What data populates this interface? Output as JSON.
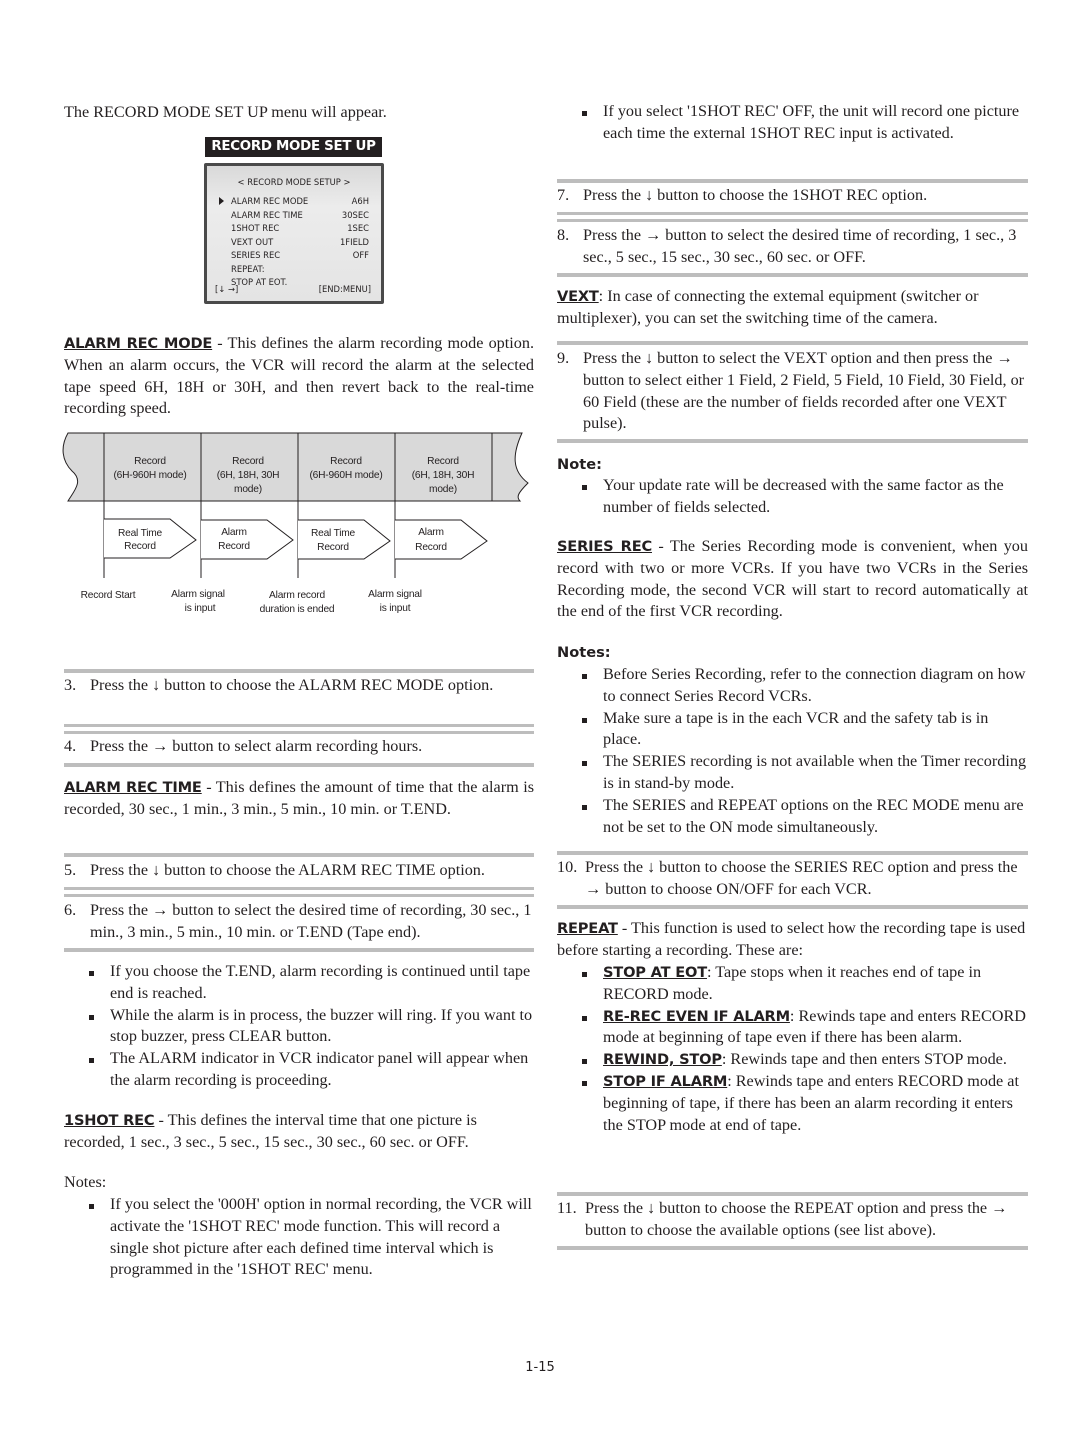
{
  "left": {
    "intro": "The RECORD MODE SET UP menu will appear.",
    "osd": {
      "title": "RECORD MODE SET UP",
      "header": "< RECORD MODE SETUP >",
      "rows": [
        {
          "label": "ALARM  REC MODE",
          "value": "A6H",
          "selected": true
        },
        {
          "label": "ALARM  REC TIME",
          "value": "30SEC"
        },
        {
          "label": "1SHOT  REC",
          "value": "1SEC"
        },
        {
          "label": "VEXT  OUT",
          "value": "1FIELD"
        },
        {
          "label": "SERIES  REC",
          "value": "OFF"
        },
        {
          "label": "REPEAT:",
          "value": ""
        },
        {
          "label": "STOP  AT  EOT.",
          "value": ""
        }
      ],
      "footer_left": "[↓   →]",
      "footer_right": "[END:MENU]"
    },
    "alarm_rec_mode": {
      "keyword": "ALARM REC MODE",
      "text": " - This defines the alarm recording mode option.  When an alarm occurs, the VCR will record the alarm at the selected tape speed 6H, 18H or 30H, and then revert back to the real-time recording speed."
    },
    "diagram": {
      "tape_segments": [
        {
          "line1": "Record",
          "line2": "(6H-960H mode)",
          "line3": ""
        },
        {
          "line1": "Record",
          "line2": "(6H, 18H, 30H",
          "line3": "mode)"
        },
        {
          "line1": "Record",
          "line2": "(6H-960H mode)",
          "line3": ""
        },
        {
          "line1": "Record",
          "line2": "(6H, 18H, 30H",
          "line3": "mode)"
        }
      ],
      "arrows": [
        {
          "line1": "Real Time",
          "line2": "Record"
        },
        {
          "line1": "Alarm",
          "line2": "Record"
        },
        {
          "line1": "Real Time",
          "line2": "Record"
        },
        {
          "line1": "Alarm",
          "line2": "Record"
        }
      ],
      "events": [
        {
          "line1": "Record Start",
          "line2": ""
        },
        {
          "line1": "Alarm signal",
          "line2": "is input"
        },
        {
          "line1": "Alarm record",
          "line2": "duration is ended"
        },
        {
          "line1": "Alarm signal",
          "line2": "is input"
        }
      ]
    },
    "step3": {
      "num": "3.",
      "text": "Press the ↓ button to choose the ALARM REC MODE option."
    },
    "step4": {
      "num": "4.",
      "text": "Press the → button to select alarm recording hours."
    },
    "alarm_rec_time": {
      "keyword": "ALARM REC TIME",
      "text": " - This defines the amount of time that the alarm is recorded, 30 sec., 1 min., 3 min., 5 min., 10 min. or T.END."
    },
    "step5": {
      "num": "5.",
      "text": "Press the ↓ button to choose the ALARM REC TIME option."
    },
    "step6": {
      "num": "6.",
      "text": "Press the → button to select the desired time of recording, 30 sec., 1 min., 3 min., 5 min., 10 min. or T.END (Tape end)."
    },
    "alarm_bullets": [
      "If you choose the T.END, alarm recording is continued until tape end is reached.",
      "While the alarm is in process, the buzzer will ring. If you want to stop buzzer, press CLEAR button.",
      "The ALARM indicator in VCR indicator panel will appear when the alarm recording is proceeding."
    ],
    "oneshot": {
      "keyword": "1SHOT REC",
      "text": " - This defines the interval time that one picture is recorded, 1 sec., 3 sec., 5 sec., 15 sec., 30 sec., 60 sec. or OFF."
    },
    "notes_label": "Notes:",
    "oneshot_bullets": [
      "If you select the '000H' option in normal recording, the VCR will activate the '1SHOT REC' mode function. This will record a single shot picture after each defined time interval which is programmed in the '1SHOT REC' menu."
    ]
  },
  "right": {
    "top_bullets": [
      "If you select '1SHOT REC' OFF, the unit will record one picture each time the external 1SHOT REC input is activated."
    ],
    "step7": {
      "num": "7.",
      "text": "Press the ↓ button to choose the 1SHOT REC option."
    },
    "step8": {
      "num": "8.",
      "text": "Press the → button to select the desired time of recording, 1 sec., 3 sec., 5 sec., 15 sec., 30 sec., 60 sec. or OFF."
    },
    "vext": {
      "keyword": "VEXT",
      "text": ": In case of connecting the extemal equipment (switcher or multiplexer), you can set the switching time of the camera."
    },
    "step9": {
      "num": "9.",
      "text": "Press the ↓ button to select the VEXT option and then press the → button to select either 1 Field, 2 Field, 5 Field, 10 Field, 30 Field, or 60 Field (these are the number of fields recorded after one VEXT pulse)."
    },
    "note_label": "Note:",
    "vext_bullets": [
      "Your update rate will be decreased with the same factor as the number of fields selected."
    ],
    "series": {
      "keyword": "SERIES REC",
      "text": " - The Series Recording mode is convenient, when you record with two or more VCRs. If you have two VCRs in the Series Recording mode, the second VCR will start to record automatically at the end of the first VCR recording."
    },
    "notes_label": "Notes:",
    "series_bullets": [
      "Before Series Recording, refer to the connection diagram on how to connect Series Record VCRs.",
      "Make sure a tape is in the each VCR and the safety tab is in place.",
      "The SERIES recording is not available when the Timer recording is in stand-by mode.",
      "The SERIES and REPEAT options on the REC MODE menu are not be set to the ON mode simultaneously."
    ],
    "step10": {
      "num": "10.",
      "text": "Press the ↓ button to choose the SERIES REC option and press the → button to choose ON/OFF for each VCR."
    },
    "repeat": {
      "keyword": "REPEAT",
      "text": " - This function is used to select how the recording tape is used before starting a recording.  These are:"
    },
    "repeat_bullets": [
      {
        "keyword": "STOP AT EOT",
        "text": ": Tape stops when it reaches end of tape in RECORD mode."
      },
      {
        "keyword": "RE-REC EVEN IF ALARM",
        "text": ": Rewinds tape and enters RECORD mode at beginning of tape even if there has been alarm."
      },
      {
        "keyword": "REWIND, STOP",
        "text": ": Rewinds tape and then enters STOP mode."
      },
      {
        "keyword": "STOP IF ALARM",
        "text": ": Rewinds tape and enters RECORD mode at beginning of tape, if there has been an alarm recording it enters the STOP mode at end of tape."
      }
    ],
    "step11": {
      "num": "11.",
      "text": "Press the ↓ button to choose the REPEAT option and press the → button to choose the available options (see list above)."
    }
  },
  "page_number": "1-15"
}
